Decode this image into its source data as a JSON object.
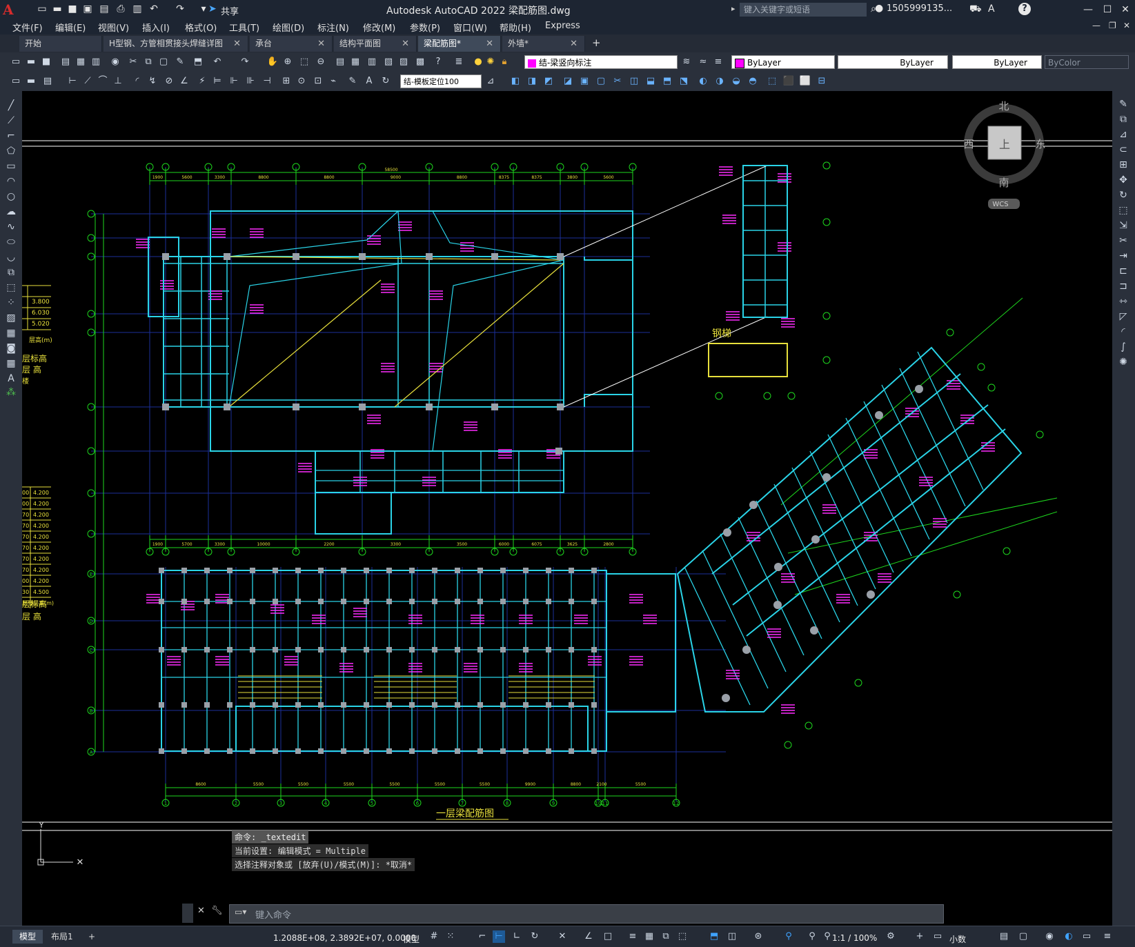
{
  "title_bar": {
    "app_icon": "A",
    "quick_access": [
      "new-icon",
      "open-icon",
      "save-icon",
      "saveas-icon",
      "plot-icon",
      "print-icon",
      "undo-icon",
      "redo-icon",
      "dropdown-icon"
    ],
    "share_label": "共享",
    "title": "Autodesk AutoCAD 2022    梁配筋图.dwg",
    "search_placeholder": "键入关键字或短语",
    "user": "1505999135...",
    "help": "?"
  },
  "menu": [
    "文件(F)",
    "编辑(E)",
    "视图(V)",
    "插入(I)",
    "格式(O)",
    "工具(T)",
    "绘图(D)",
    "标注(N)",
    "修改(M)",
    "参数(P)",
    "窗口(W)",
    "帮助(H)",
    "Express"
  ],
  "tabs": [
    {
      "label": "开始",
      "active": false
    },
    {
      "label": "H型钢、方管相贯接头焊缝详图",
      "active": false
    },
    {
      "label": "承台",
      "active": false
    },
    {
      "label": "结构平面图",
      "active": false
    },
    {
      "label": "梁配筋图*",
      "active": true
    },
    {
      "label": "外墙*",
      "active": false
    }
  ],
  "add_tab": "+",
  "toolbar1": {
    "layer": "结-梁竖向标注",
    "layer_color": "#ff00ff",
    "color": "ByLayer",
    "linetype": "ByLayer",
    "lineweight": "ByLayer",
    "plotstyle": "ByColor"
  },
  "toolbar2": {
    "dim_style": "结-模板定位100"
  },
  "viewcube": {
    "north": "北",
    "south": "南",
    "east": "东",
    "west": "西",
    "top": "上",
    "wcs": "WCS"
  },
  "drawing": {
    "title": "一层梁配筋图",
    "stair_label": "钢梯",
    "top_plan_dims": [
      "1900",
      "5600",
      "3300",
      "8800",
      "8800",
      "9000",
      "8800",
      "8375",
      "8375",
      "3800",
      "5600"
    ],
    "top_plan_total": "58500",
    "bottom_plan_dims": [
      "1900",
      "5700",
      "3300",
      "10000",
      "2200",
      "3300",
      "3500",
      "6000",
      "6075",
      "3625",
      "2800"
    ],
    "bottom_grid_dims": [
      "8600",
      "5500",
      "5500",
      "5500",
      "5500",
      "5500",
      "5500",
      "9900",
      "8800",
      "2100",
      "5500"
    ],
    "axis_bubbles_bottom": [
      "1",
      "2",
      "3",
      "4",
      "5",
      "6",
      "7",
      "8",
      "9",
      "10",
      "11",
      "12"
    ],
    "axis_bubbles_left_bottom": [
      "E",
      "D",
      "C",
      "B",
      "A"
    ],
    "elev_table_1": [
      [
        "",
        "3.800"
      ],
      [
        "",
        "6.030"
      ],
      [
        "",
        "5.020"
      ],
      [
        "层号",
        "层高(m)"
      ]
    ],
    "elev_table_2": [
      [
        "00",
        "4.200"
      ],
      [
        "00",
        "4.200"
      ],
      [
        "70",
        "4.200"
      ],
      [
        "70",
        "4.200"
      ],
      [
        "70",
        "4.200"
      ],
      [
        "70",
        "4.200"
      ],
      [
        "70",
        "4.200"
      ],
      [
        "70",
        "4.200"
      ],
      [
        "00",
        "4.200"
      ],
      [
        "30",
        "4.500"
      ],
      [
        "层号",
        "层高(m)"
      ]
    ],
    "legend_1": [
      "层标高",
      "层 高",
      "楼"
    ],
    "legend_2": [
      "层标高",
      "层 高"
    ]
  },
  "command": {
    "history": [
      "命令: _textedit",
      "当前设置: 编辑模式 = Multiple",
      "选择注释对象或 [放弃(U)/模式(M)]: *取消*"
    ],
    "placeholder": "键入命令"
  },
  "status": {
    "layouts": [
      {
        "label": "模型",
        "active": true
      },
      {
        "label": "布局1",
        "active": false
      }
    ],
    "add": "+",
    "coords": "1.2088E+08, 2.3892E+07, 0.0000",
    "space": "模型",
    "scale": "1:1 / 100%",
    "units": "小数"
  }
}
